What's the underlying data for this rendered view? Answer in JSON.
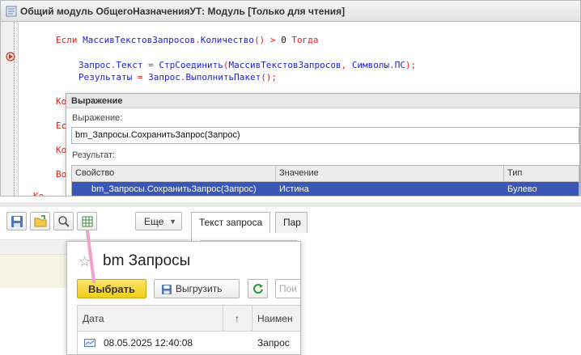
{
  "module": {
    "title": "Общий модуль ОбщегоНазначенияУТ: Модуль [Только для чтения]",
    "line1": {
      "kw1": "Если",
      "id1": "МассивТекстовЗапросов",
      "dot": ".",
      "id2": "Количество",
      "paren": "()",
      "gt": " > ",
      "num": "0",
      "kw2": " Тогда"
    },
    "line2": {
      "id1": "Запрос",
      "dot": ".",
      "id2": "Текст",
      "eq": " = ",
      "id3": "СтрСоединить",
      "op": "(",
      "id4": "МассивТекстовЗапросов",
      "comma": ", ",
      "id5": "Символы",
      "dot2": ".",
      "id6": "ПС",
      "cl": ");"
    },
    "line3": {
      "id1": "Результаты",
      "eq": " = ",
      "id2": "Запрос",
      "dot": ".",
      "id3": "ВыполнитьПакет",
      "cl": "();"
    },
    "side_fragments": [
      "Ко",
      "Ес",
      "Ко",
      "Во",
      "Ко"
    ]
  },
  "expression_dialog": {
    "title": "Выражение",
    "expression_label": "Выражение:",
    "expression_value": "bm_Запросы.СохранитьЗапрос(Запрос)",
    "result_label": "Результат:",
    "columns": [
      "Свойство",
      "Значение",
      "Тип"
    ],
    "row": [
      "bm_Запросы.СохранитьЗапрос(Запрос)",
      "Истина",
      "Булево"
    ]
  },
  "toolbar": {
    "more_label": "Еще"
  },
  "tabs": [
    "Текст запроса",
    "Пар"
  ],
  "popup": {
    "title": "bm Запросы",
    "select_label": "Выбрать",
    "export_label": "Выгрузить",
    "search_placeholder": "Пои",
    "columns": [
      "Дата",
      "↑",
      "Наимен"
    ],
    "row": {
      "date": "08.05.2025 12:40:08",
      "name": "Запрос"
    }
  },
  "colors": {
    "keyword": "#e02020",
    "identifier": "#2020d8",
    "selection": "#3a57b6",
    "select_button": "#f2cf1b",
    "arrow": "#f4a0c8"
  }
}
